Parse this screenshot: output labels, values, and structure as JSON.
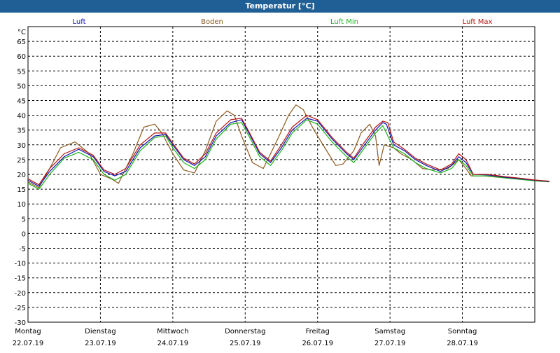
{
  "window": {
    "title": "Temperatur [°C]"
  },
  "colors": {
    "luft": "#1414b4",
    "boden": "#8a5a1e",
    "luft_min": "#18b418",
    "luft_max": "#b41414",
    "grid": "#000000",
    "title_bg": "#1f5f96"
  },
  "chart_data": {
    "type": "line",
    "title": "Temperatur [°C]",
    "xlabel": "",
    "ylabel": "°C",
    "ylim": [
      -30,
      70
    ],
    "yticks": [
      65,
      60,
      55,
      50,
      45,
      40,
      35,
      30,
      25,
      20,
      15,
      10,
      5,
      0,
      -5,
      -10,
      -15,
      -20,
      -25,
      -30
    ],
    "xlim": [
      0,
      7
    ],
    "grid": true,
    "legend_position": "top",
    "day_labels": [
      {
        "weekday": "Montag",
        "date": "22.07.19"
      },
      {
        "weekday": "Dienstag",
        "date": "23.07.19"
      },
      {
        "weekday": "Mittwoch",
        "date": "24.07.19"
      },
      {
        "weekday": "Donnerstag",
        "date": "25.07.19"
      },
      {
        "weekday": "Freitag",
        "date": "26.07.19"
      },
      {
        "weekday": "Samstag",
        "date": "27.07.19"
      },
      {
        "weekday": "Sonntag",
        "date": "28.07.19"
      }
    ],
    "series": [
      {
        "name": "Luft",
        "color_key": "luft",
        "points": [
          [
            0,
            18
          ],
          [
            0.15,
            16
          ],
          [
            0.3,
            21
          ],
          [
            0.5,
            26
          ],
          [
            0.7,
            28.5
          ],
          [
            0.9,
            26
          ],
          [
            1.05,
            21
          ],
          [
            1.2,
            19.5
          ],
          [
            1.35,
            21
          ],
          [
            1.55,
            29
          ],
          [
            1.75,
            33
          ],
          [
            1.9,
            33.5
          ],
          [
            2.0,
            30
          ],
          [
            2.15,
            25
          ],
          [
            2.3,
            23
          ],
          [
            2.45,
            26
          ],
          [
            2.6,
            33
          ],
          [
            2.8,
            37.5
          ],
          [
            2.95,
            38.5
          ],
          [
            3.05,
            34
          ],
          [
            3.2,
            27
          ],
          [
            3.35,
            24
          ],
          [
            3.5,
            29
          ],
          [
            3.65,
            35
          ],
          [
            3.85,
            39
          ],
          [
            4.0,
            38
          ],
          [
            4.2,
            32
          ],
          [
            4.4,
            27
          ],
          [
            4.5,
            25
          ],
          [
            4.65,
            30
          ],
          [
            4.8,
            35
          ],
          [
            4.9,
            37.5
          ],
          [
            4.95,
            37
          ],
          [
            5.05,
            30
          ],
          [
            5.2,
            28
          ],
          [
            5.35,
            25
          ],
          [
            5.5,
            23
          ],
          [
            5.7,
            21
          ],
          [
            5.85,
            23
          ],
          [
            5.95,
            26
          ],
          [
            6.05,
            24
          ],
          [
            6.15,
            20
          ],
          [
            6.35,
            19.8
          ],
          [
            6.6,
            19
          ],
          [
            6.8,
            18.5
          ],
          [
            7.0,
            18
          ],
          [
            7.2,
            17.6
          ]
        ]
      },
      {
        "name": "Boden",
        "color_key": "boden",
        "points": [
          [
            0,
            17.5
          ],
          [
            0.15,
            15.5
          ],
          [
            0.3,
            22
          ],
          [
            0.45,
            29
          ],
          [
            0.65,
            31
          ],
          [
            0.85,
            27
          ],
          [
            1.0,
            20
          ],
          [
            1.15,
            18.5
          ],
          [
            1.25,
            17
          ],
          [
            1.45,
            27
          ],
          [
            1.6,
            36
          ],
          [
            1.75,
            37
          ],
          [
            1.85,
            34
          ],
          [
            2.0,
            27
          ],
          [
            2.15,
            21.5
          ],
          [
            2.3,
            20.5
          ],
          [
            2.45,
            28
          ],
          [
            2.6,
            38
          ],
          [
            2.75,
            41.5
          ],
          [
            2.85,
            40
          ],
          [
            2.95,
            33
          ],
          [
            3.1,
            24
          ],
          [
            3.25,
            22
          ],
          [
            3.45,
            32
          ],
          [
            3.6,
            40
          ],
          [
            3.7,
            43.5
          ],
          [
            3.8,
            42
          ],
          [
            3.95,
            35
          ],
          [
            4.1,
            29
          ],
          [
            4.25,
            23
          ],
          [
            4.35,
            23.5
          ],
          [
            4.5,
            28
          ],
          [
            4.6,
            34
          ],
          [
            4.72,
            37
          ],
          [
            4.8,
            33
          ],
          [
            4.85,
            23
          ],
          [
            4.92,
            30
          ],
          [
            5.05,
            29
          ],
          [
            5.15,
            27
          ],
          [
            5.3,
            25
          ],
          [
            5.45,
            22
          ],
          [
            5.6,
            21.5
          ],
          [
            5.8,
            22
          ],
          [
            5.95,
            25
          ],
          [
            6.05,
            22
          ],
          [
            6.12,
            19.5
          ],
          [
            6.3,
            19.5
          ],
          [
            6.6,
            18.8
          ],
          [
            6.9,
            18.2
          ],
          [
            7.2,
            17.7
          ]
        ]
      },
      {
        "name": "Luft Min",
        "color_key": "luft_min",
        "points": [
          [
            0,
            17
          ],
          [
            0.15,
            15
          ],
          [
            0.3,
            20
          ],
          [
            0.5,
            25.5
          ],
          [
            0.7,
            27.5
          ],
          [
            0.9,
            25
          ],
          [
            1.05,
            20
          ],
          [
            1.2,
            18
          ],
          [
            1.35,
            20
          ],
          [
            1.55,
            28
          ],
          [
            1.75,
            32.5
          ],
          [
            1.9,
            33
          ],
          [
            2.0,
            29
          ],
          [
            2.15,
            24
          ],
          [
            2.3,
            22
          ],
          [
            2.45,
            25
          ],
          [
            2.6,
            32
          ],
          [
            2.8,
            37
          ],
          [
            2.95,
            37.5
          ],
          [
            3.05,
            33
          ],
          [
            3.2,
            26
          ],
          [
            3.35,
            23
          ],
          [
            3.5,
            28
          ],
          [
            3.65,
            34
          ],
          [
            3.85,
            38.5
          ],
          [
            4.0,
            37
          ],
          [
            4.2,
            31
          ],
          [
            4.4,
            26
          ],
          [
            4.5,
            24
          ],
          [
            4.65,
            29
          ],
          [
            4.8,
            34
          ],
          [
            4.9,
            36.5
          ],
          [
            4.97,
            33
          ],
          [
            5.05,
            29
          ],
          [
            5.2,
            27
          ],
          [
            5.35,
            24
          ],
          [
            5.5,
            22
          ],
          [
            5.7,
            20.5
          ],
          [
            5.85,
            22
          ],
          [
            5.95,
            25
          ],
          [
            6.05,
            23
          ],
          [
            6.15,
            19.5
          ],
          [
            6.35,
            19.5
          ],
          [
            6.6,
            18.8
          ],
          [
            6.8,
            18.3
          ],
          [
            7.0,
            17.8
          ],
          [
            7.2,
            17.5
          ]
        ]
      },
      {
        "name": "Luft Max",
        "color_key": "luft_max",
        "points": [
          [
            0,
            18.5
          ],
          [
            0.15,
            16.5
          ],
          [
            0.3,
            22
          ],
          [
            0.5,
            27
          ],
          [
            0.7,
            29
          ],
          [
            0.9,
            26.5
          ],
          [
            1.05,
            21.5
          ],
          [
            1.2,
            20
          ],
          [
            1.35,
            22
          ],
          [
            1.55,
            30
          ],
          [
            1.75,
            34
          ],
          [
            1.9,
            34
          ],
          [
            2.0,
            30.5
          ],
          [
            2.15,
            25.5
          ],
          [
            2.3,
            23.5
          ],
          [
            2.45,
            27
          ],
          [
            2.6,
            34
          ],
          [
            2.8,
            38.5
          ],
          [
            2.95,
            39
          ],
          [
            3.05,
            34.5
          ],
          [
            3.2,
            27.5
          ],
          [
            3.35,
            24.5
          ],
          [
            3.5,
            30
          ],
          [
            3.65,
            36
          ],
          [
            3.85,
            40
          ],
          [
            4.0,
            38.5
          ],
          [
            4.2,
            32.5
          ],
          [
            4.4,
            27.5
          ],
          [
            4.5,
            25.5
          ],
          [
            4.65,
            31
          ],
          [
            4.8,
            36
          ],
          [
            4.9,
            38
          ],
          [
            4.97,
            37.5
          ],
          [
            5.05,
            31
          ],
          [
            5.2,
            28.5
          ],
          [
            5.35,
            25.5
          ],
          [
            5.5,
            23.5
          ],
          [
            5.7,
            21.5
          ],
          [
            5.85,
            23.5
          ],
          [
            5.95,
            27
          ],
          [
            6.05,
            25
          ],
          [
            6.15,
            20
          ],
          [
            6.35,
            20
          ],
          [
            6.6,
            19.2
          ],
          [
            6.8,
            18.7
          ],
          [
            7.0,
            18.1
          ],
          [
            7.2,
            17.7
          ]
        ]
      }
    ]
  }
}
